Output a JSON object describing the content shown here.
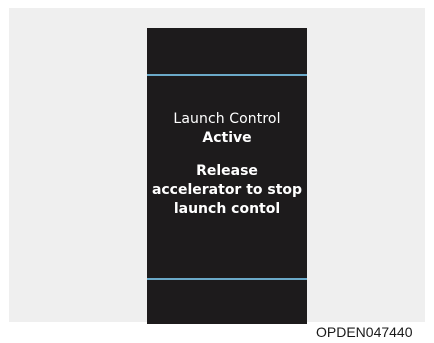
{
  "display": {
    "title": "Launch Control",
    "status": "Active",
    "instruction_lines": [
      "Release",
      "accelerator to stop",
      "launch contol"
    ]
  },
  "caption": "OPDEN047440",
  "colors": {
    "screen_background": "#1d1b1c",
    "divider_line": "#6ba9c8",
    "panel_background": "#efefef",
    "text": "#ffffff"
  }
}
